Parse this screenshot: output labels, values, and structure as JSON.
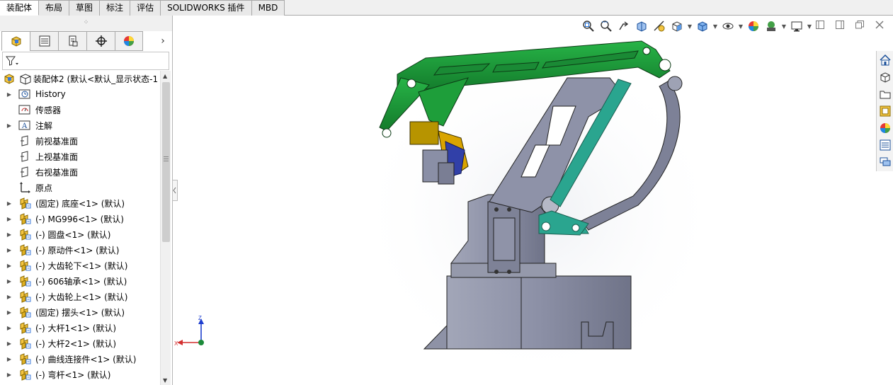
{
  "tabs": [
    "装配体",
    "布局",
    "草图",
    "标注",
    "评估",
    "SOLIDWORKS 插件",
    "MBD"
  ],
  "active_tab": "装配体",
  "hud_icons": [
    "zoom-to-fit-icon",
    "zoom-to-area-icon",
    "previous-view-icon",
    "section-view-icon",
    "dynamic-annotation-view-icon",
    "view-orientation-icon",
    "display-style-icon",
    "hide-show-items-icon",
    "edit-appearance-icon",
    "apply-scene-icon",
    "view-settings-icon"
  ],
  "feature_manager": {
    "grip": "⁘",
    "tabs": [
      "featuremanager-icon",
      "propertymanager-icon",
      "configurationmanager-icon",
      "dimxpertmanager-icon",
      "displaymanager-icon"
    ],
    "root": "装配体2  (默认<默认_显示状态-1",
    "items": [
      {
        "label": "History",
        "icon": "history-icon",
        "expandable": true
      },
      {
        "label": "传感器",
        "icon": "sensor-icon",
        "expandable": false
      },
      {
        "label": "注解",
        "icon": "annotation-icon",
        "expandable": true
      },
      {
        "label": "前视基准面",
        "icon": "plane-icon",
        "expandable": false
      },
      {
        "label": "上视基准面",
        "icon": "plane-icon",
        "expandable": false
      },
      {
        "label": "右视基准面",
        "icon": "plane-icon",
        "expandable": false
      },
      {
        "label": "原点",
        "icon": "origin-icon",
        "expandable": false
      },
      {
        "label": "(固定) 底座<1> (默认)",
        "icon": "part-icon",
        "expandable": true
      },
      {
        "label": "(-) MG996<1> (默认)",
        "icon": "part-icon",
        "expandable": true
      },
      {
        "label": "(-) 圆盘<1> (默认)",
        "icon": "part-icon",
        "expandable": true
      },
      {
        "label": "(-) 原动件<1> (默认)",
        "icon": "part-icon",
        "expandable": true
      },
      {
        "label": "(-) 大齿轮下<1> (默认)",
        "icon": "part-icon",
        "expandable": true
      },
      {
        "label": "(-) 606轴承<1> (默认)",
        "icon": "part-icon",
        "expandable": true
      },
      {
        "label": "(-) 大齿轮上<1> (默认)",
        "icon": "part-icon",
        "expandable": true
      },
      {
        "label": "(固定) 摆头<1> (默认)",
        "icon": "part-icon",
        "expandable": true
      },
      {
        "label": "(-) 大杆1<1> (默认)",
        "icon": "part-icon",
        "expandable": true
      },
      {
        "label": "(-) 大杆2<1> (默认)",
        "icon": "part-icon",
        "expandable": true
      },
      {
        "label": "(-) 曲线连接件<1> (默认)",
        "icon": "part-icon",
        "expandable": true
      },
      {
        "label": "(-) 弯杆<1> (默认)",
        "icon": "part-icon",
        "expandable": true
      }
    ]
  },
  "triad": {
    "x": "X",
    "z": "Z"
  },
  "task_pane": [
    "solidworks-resources-icon",
    "design-library-icon",
    "file-explorer-icon",
    "view-palette-icon",
    "appearances-icon",
    "custom-properties-icon",
    "forum-icon"
  ],
  "colors": {
    "green": "#1e9e3a",
    "teal": "#2aa58f",
    "gray": "#8a8fa6",
    "accent": "#d9a400"
  }
}
